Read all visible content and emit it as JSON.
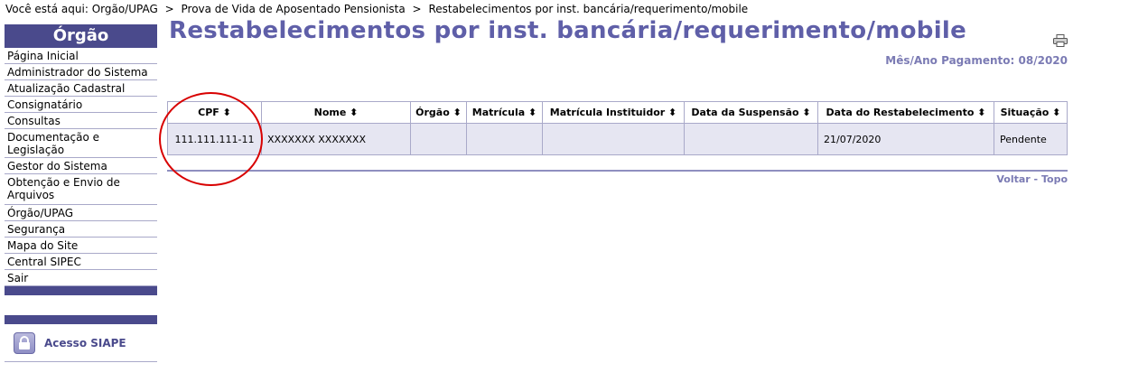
{
  "breadcrumb": {
    "prefix": "Você está aqui:",
    "items": [
      "Orgão/UPAG",
      "Prova de Vida de Aposentado Pensionista",
      "Restabelecimentos por inst. bancária/requerimento/mobile"
    ],
    "separator": ">"
  },
  "sidebar": {
    "header": "Órgão",
    "items": [
      {
        "label": "Página Inicial"
      },
      {
        "label": "Administrador do Sistema"
      },
      {
        "label": "Atualização Cadastral"
      },
      {
        "label": "Consignatário"
      },
      {
        "label": "Consultas"
      },
      {
        "label": "Documentação e Legislação"
      },
      {
        "label": "Gestor do Sistema"
      },
      {
        "label": "Obtenção e Envio de Arquivos"
      },
      {
        "label": "Órgão/UPAG"
      },
      {
        "label": "Segurança"
      },
      {
        "label": "Mapa do Site"
      },
      {
        "label": "Central SIPEC"
      },
      {
        "label": "Sair"
      }
    ],
    "siape_label": "Acesso SIAPE"
  },
  "page": {
    "title": "Restabelecimentos por inst. bancária/requerimento/mobile",
    "mes_ano": "Mês/Ano Pagamento: 08/2020"
  },
  "table": {
    "headers": [
      "CPF ⬍",
      "Nome ⬍",
      "Órgão ⬍",
      "Matrícula ⬍",
      "Matrícula Instituidor ⬍",
      "Data da Suspensão ⬍",
      "Data do Restabelecimento ⬍",
      "Situação ⬍"
    ],
    "rows": [
      [
        "111.111.111-11",
        "XXXXXXX XXXXXXX",
        "",
        "",
        "",
        "",
        "21/07/2020",
        "Pendente"
      ]
    ]
  },
  "footer": {
    "voltar": "Voltar",
    "dash": "-",
    "topo": "Topo"
  },
  "colors": {
    "accent": "#4a4a8c",
    "title": "#5f5fa8",
    "row_bg": "#e6e6f2",
    "annotation": "#d80000"
  }
}
